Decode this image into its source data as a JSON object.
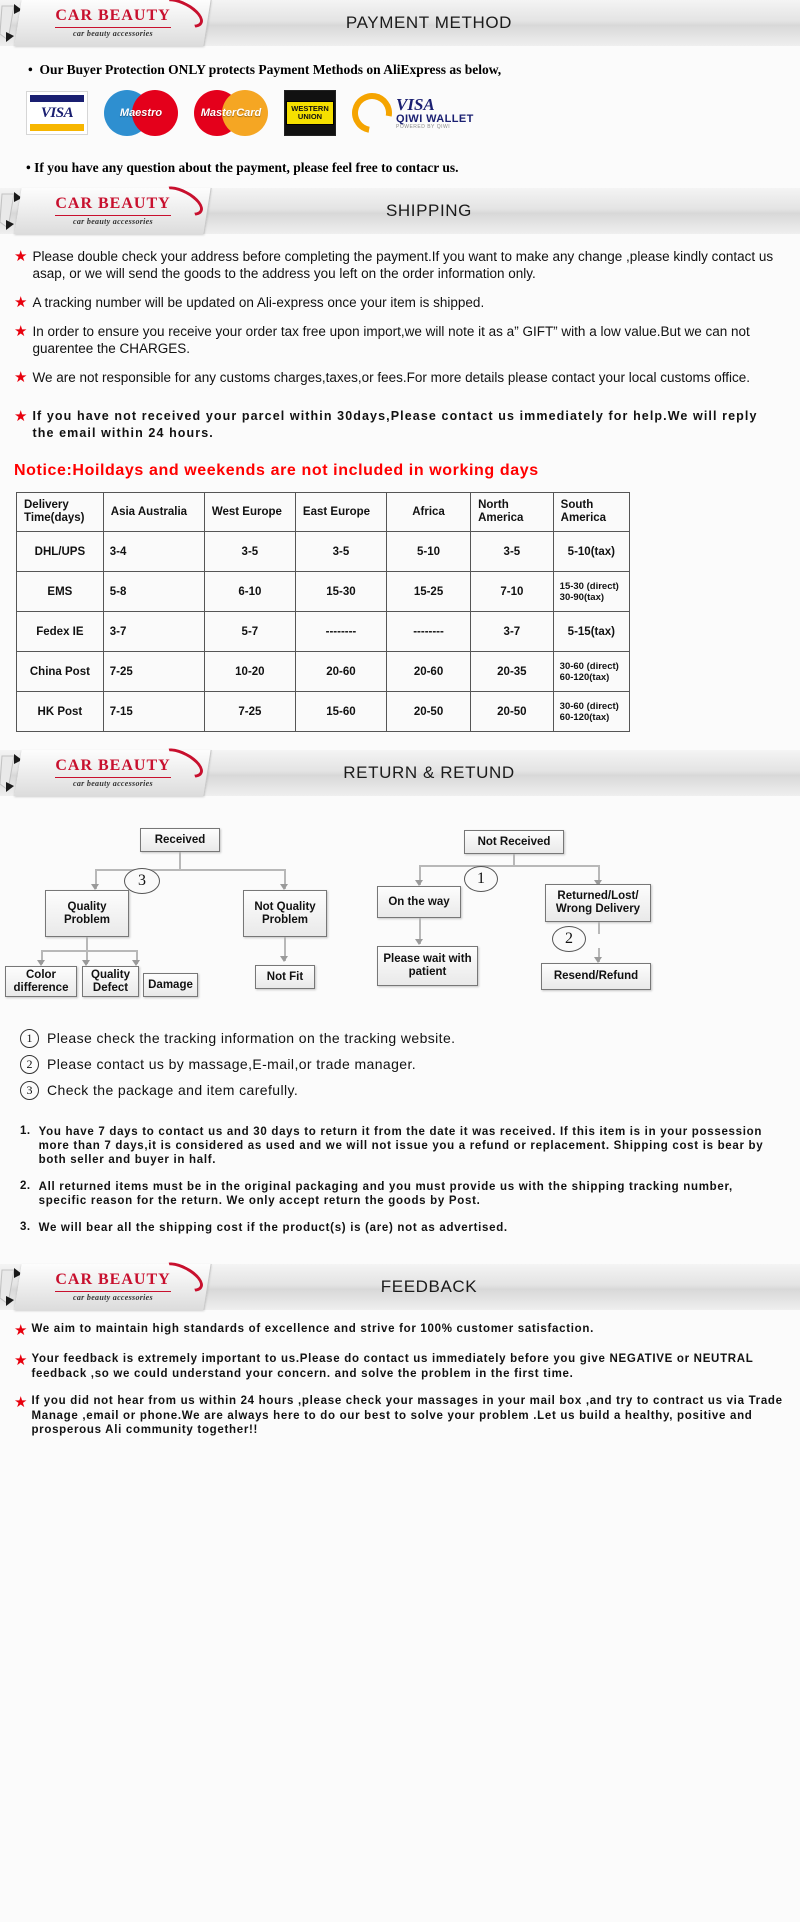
{
  "brand": {
    "name_top": "CAR  BEAUTY",
    "name_sub": "car beauty accessories"
  },
  "sections": {
    "payment": {
      "title": "PAYMENT METHOD",
      "line1": "Our Buyer Protection ONLY protects Payment Methods on AliExpress as below,",
      "line2": "If you have any question about the payment, please feel free to contacr us.",
      "logos": [
        {
          "name": "visa-logo",
          "label": "VISA"
        },
        {
          "name": "maestro-logo",
          "label": "Maestro"
        },
        {
          "name": "mastercard-logo",
          "label": "MasterCard"
        },
        {
          "name": "western-union-logo",
          "label_line1": "WESTERN",
          "label_line2": "UNION"
        },
        {
          "name": "qiwi-wallet-logo",
          "visa": "VISA",
          "wallet": "QIWI WALLET",
          "powered": "POWERED BY QIWI"
        }
      ]
    },
    "shipping": {
      "title": "SHIPPING",
      "bullets": [
        "Please double check your address before completing the payment.If you want to make any change ,please kindly contact us asap, or we will send the goods to the address you left on the order information only.",
        "A tracking number will be updated on Ali-express once your item is shipped.",
        "In order to ensure you receive your order tax free upon import,we will note it as a” GIFT” with a low value.But we can not guarentee the CHARGES.",
        "We are not responsible for any customs charges,taxes,or fees.For more details please contact your local customs office."
      ],
      "bullet_wide": "If you have not received your parcel within 30days,Please contact us immediately for help.We will reply the email within 24 hours.",
      "notice": "Notice:Hoildays and weekends are not included in working days",
      "table": {
        "headers": [
          "Delivery Time(days)",
          "Asia Australia",
          "West Europe",
          "East Europe",
          "Africa",
          "North America",
          "South America"
        ],
        "rows": [
          {
            "method": "DHL/UPS",
            "cells": [
              "3-4",
              "3-5",
              "3-5",
              "5-10",
              "3-5",
              "5-10(tax)"
            ]
          },
          {
            "method": "EMS",
            "cells": [
              "5-8",
              "6-10",
              "15-30",
              "15-25",
              "7-10",
              "15-30 (direct) 30-90(tax)"
            ]
          },
          {
            "method": "Fedex IE",
            "cells": [
              "3-7",
              "5-7",
              "--------",
              "--------",
              "3-7",
              "5-15(tax)"
            ]
          },
          {
            "method": "China Post",
            "cells": [
              "7-25",
              "10-20",
              "20-60",
              "20-60",
              "20-35",
              "30-60 (direct) 60-120(tax)"
            ]
          },
          {
            "method": "HK Post",
            "cells": [
              "7-15",
              "7-25",
              "15-60",
              "20-50",
              "20-50",
              "30-60 (direct) 60-120(tax)"
            ]
          }
        ]
      }
    },
    "returns": {
      "title": "RETURN & RETUND",
      "flow": {
        "received": "Received",
        "quality_problem": "Quality Problem",
        "not_quality_problem": "Not Quality Problem",
        "color_difference": "Color difference",
        "quality_defect": "Quality Defect",
        "damage": "Damage",
        "not_fit": "Not Fit",
        "not_received": "Not  Received",
        "on_the_way": "On the way",
        "returned_lost": "Returned/Lost/ Wrong Delivery",
        "please_wait": "Please wait with patient",
        "resend_refund": "Resend/Refund",
        "marker1": "1",
        "marker2": "2",
        "marker3": "3"
      },
      "notes": [
        {
          "num": "1",
          "text": "Please check the tracking information on the tracking website."
        },
        {
          "num": "2",
          "text": "Please contact us by  massage,E-mail,or trade manager."
        },
        {
          "num": "3",
          "text": "Check the package and item carefully."
        }
      ],
      "terms": [
        {
          "idx": "1.",
          "text": "You have 7 days to contact us and 30 days to return it from the date it was received. If this item is in your possession more than 7 days,it is considered as used and we will not issue you a refund or replacement. Shipping cost is bear by both seller and buyer in half."
        },
        {
          "idx": "2.",
          "text": "All returned items must be in the original packaging and you must provide us with the shipping tracking number, specific reason for the return. We only accept return the goods by Post."
        },
        {
          "idx": "3.",
          "text": "We will bear all the shipping cost if the product(s) is (are) not as advertised."
        }
      ]
    },
    "feedback": {
      "title": "FEEDBACK",
      "items": [
        "We aim to maintain high standards of excellence and strive  for 100% customer satisfaction.",
        "Your feedback is extremely important to us.Please do contact us immediately before you give NEGATIVE or NEUTRAL feedback ,so  we could understand your concern. and solve the problem in the first time.",
        "If you did not hear from us within 24 hours ,please check your massages in your mail box ,and try to contract us via Trade Manage ,email or phone.We are always here to do our best to solve your problem .Let us build a healthy, positive and prosperous Ali community together!!"
      ]
    }
  },
  "colors": {
    "brand_red": "#c8102e",
    "star_red": "#e8000d",
    "notice_red": "#ff0000"
  }
}
